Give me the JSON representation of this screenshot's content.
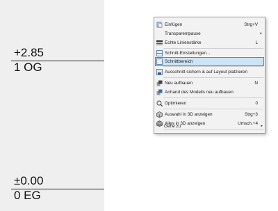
{
  "levels": [
    {
      "elevation": "+2.85",
      "name": "1 OG"
    },
    {
      "elevation": "±0.00",
      "name": "0 EG"
    }
  ],
  "context_menu": {
    "items": [
      {
        "label": "Einfügen",
        "shortcut": "Strg+V",
        "icon": "paste-icon"
      },
      {
        "label": "Transparentpause",
        "shortcut": "",
        "icon": "",
        "submenu": "▸"
      },
      {
        "label": "Echte Linienstärke",
        "shortcut": "L",
        "icon": "line-weight-icon"
      },
      {
        "label": "Schnitt-Einstellungen...",
        "shortcut": "",
        "icon": "section-settings-icon"
      },
      {
        "label": "Schnittbereich",
        "shortcut": "",
        "icon": "section-area-icon",
        "highlighted": true
      },
      {
        "label": "Ausschnitt sichern & auf Layout platzieren",
        "shortcut": "",
        "icon": "save-view-icon"
      },
      {
        "label": "Neu aufbauen",
        "shortcut": "N",
        "icon": "rebuild-icon"
      },
      {
        "label": "Anhand des Modells neu aufbauen",
        "shortcut": "",
        "icon": "rebuild-model-icon"
      },
      {
        "label": "Optimieren",
        "shortcut": "0",
        "icon": "zoom-fit-icon"
      },
      {
        "label": "Auswahl in 3D anzeigen",
        "shortcut": "Strg+3",
        "icon": "show-3d-icon"
      },
      {
        "label": "Alles in 3D anzeigen",
        "shortcut": "Umsch.+4",
        "icon": "show-all-3d-icon"
      },
      {
        "label": "Gehe zu",
        "shortcut": "",
        "icon": "",
        "submenu": "▸"
      }
    ]
  },
  "colors": {
    "highlight_bg": "#cce4f7",
    "highlight_border": "#3d8fd6",
    "panel_bg": "#efefef"
  }
}
